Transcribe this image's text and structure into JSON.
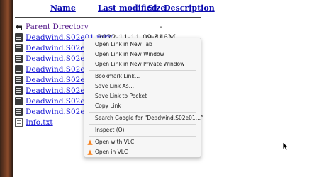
{
  "header": {
    "name": "Name",
    "last_modified": "Last modified",
    "size": "Size",
    "description": "Description"
  },
  "listing": {
    "parent": {
      "label": "Parent Directory",
      "size": "-"
    },
    "files": [
      {
        "name": "Deadwind.S02e01.mkv",
        "modified": "2022-11-11 09:44",
        "size": "816M"
      },
      {
        "name": "Deadwind.S02e02.mkv"
      },
      {
        "name": "Deadwind.S02e03.mkv"
      },
      {
        "name": "Deadwind.S02e04.mkv"
      },
      {
        "name": "Deadwind.S02e05.mkv"
      },
      {
        "name": "Deadwind.S02e06.mkv"
      },
      {
        "name": "Deadwind.S02e07.mkv"
      },
      {
        "name": "Deadwind.S02e08.mkv"
      }
    ],
    "info": {
      "name": "Info.txt"
    }
  },
  "context_menu": {
    "items": [
      "Open Link in New Tab",
      "Open Link in New Window",
      "Open Link in New Private Window",
      "Bookmark Link…",
      "Save Link As…",
      "Save Link to Pocket",
      "Copy Link",
      "Search Google for “Deadwind.S02e01…”",
      "Inspect (Q)",
      "Open with VLC",
      "Open in VLC"
    ]
  },
  "colors": {
    "link": "#1a1ad6",
    "visited": "#551a8b",
    "vlc_orange": "#f58220"
  },
  "icons": [
    "back-arrow-icon",
    "video-file-icon",
    "text-file-icon",
    "vlc-cone-icon",
    "mouse-pointer-icon"
  ]
}
